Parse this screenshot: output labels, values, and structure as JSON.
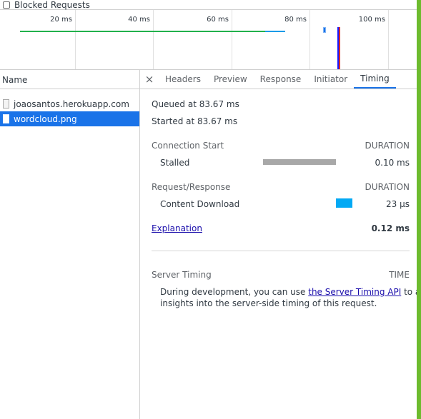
{
  "blocked": {
    "label": "Blocked Requests"
  },
  "overview": {
    "ticks": [
      "20 ms",
      "40 ms",
      "60 ms",
      "80 ms",
      "100 ms"
    ]
  },
  "network": {
    "name_header": "Name",
    "requests": [
      {
        "name": "joaosantos.herokuapp.com",
        "selected": false
      },
      {
        "name": "wordcloud.png",
        "selected": true
      }
    ]
  },
  "tabs": {
    "close_glyph": "×",
    "items": [
      "Headers",
      "Preview",
      "Response",
      "Initiator",
      "Timing"
    ],
    "active": "Timing"
  },
  "timing": {
    "queued": "Queued at 83.67 ms",
    "started": "Started at 83.67 ms",
    "connection_start": "Connection Start",
    "duration_label_1": "DURATION",
    "stalled_label": "Stalled",
    "stalled_value": "0.10 ms",
    "request_response": "Request/Response",
    "duration_label_2": "DURATION",
    "content_download_label": "Content Download",
    "content_download_value": "23 µs",
    "explanation_link": "Explanation",
    "total": "0.12 ms",
    "server_timing": "Server Timing",
    "time_label": "TIME",
    "server_text_1": "During development, you can use ",
    "server_link": "the Server Timing API",
    "server_text_2": " to add",
    "server_text_3": "insights into the server-side timing of this request."
  },
  "colors": {
    "stalled_bar": "#a8a8a8",
    "download_bar": "#03a9f4",
    "selected_row": "#1a73e8",
    "overview_green": "#22b14c",
    "overview_blue": "#1a9be8",
    "edge_green": "#6dbb2e"
  }
}
